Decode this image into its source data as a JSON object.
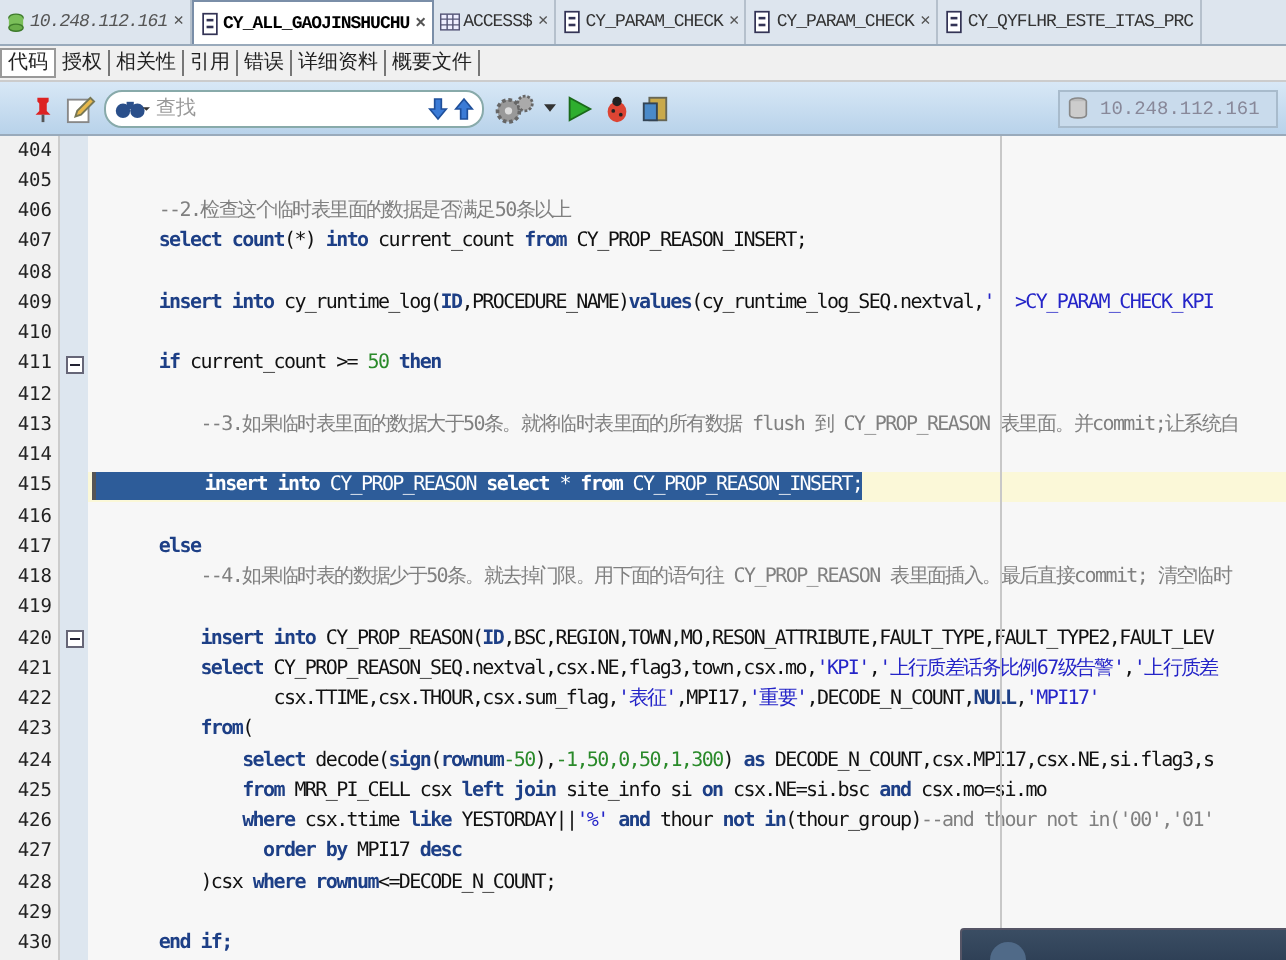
{
  "tabs": [
    {
      "label": "10.248.112.161",
      "kind": "connection",
      "selected": false,
      "close": "×"
    },
    {
      "label": "CY_ALL_GAOJINSHUCHU",
      "kind": "package",
      "selected": true,
      "close": "×"
    },
    {
      "label": "ACCESS$",
      "kind": "table",
      "selected": false,
      "close": "×"
    },
    {
      "label": "CY_PARAM_CHECK",
      "kind": "package",
      "selected": false,
      "close": "×"
    },
    {
      "label": "CY_PARAM_CHECK",
      "kind": "package",
      "selected": false,
      "close": "×"
    },
    {
      "label": "CY_QYFLHR_ESTE_ITAS_PRC",
      "kind": "package",
      "selected": false
    }
  ],
  "subtabs": [
    {
      "label": "代码",
      "selected": true
    },
    {
      "label": "授权",
      "selected": false
    },
    {
      "label": "相关性",
      "selected": false
    },
    {
      "label": "引用",
      "selected": false
    },
    {
      "label": "错误",
      "selected": false
    },
    {
      "label": "详细资料",
      "selected": false
    },
    {
      "label": "概要文件",
      "selected": false
    }
  ],
  "toolbar": {
    "search_placeholder": "查找",
    "connection": "10.248.112.161"
  },
  "lines": [
    {
      "number": "404",
      "fold": false,
      "selected": false
    },
    {
      "number": "405",
      "fold": false,
      "selected": false
    },
    {
      "number": "406",
      "fold": false,
      "selected": false,
      "segments": [
        {
          "kind": "comment",
          "text": "      --2.检查这个临时表里面的数据是否满足50条以上"
        }
      ]
    },
    {
      "number": "407",
      "fold": false,
      "selected": false,
      "segments": [
        {
          "kind": "keyword",
          "text": "      select "
        },
        {
          "kind": "keyword",
          "text": "count"
        },
        {
          "kind": "plain",
          "text": "(*) "
        },
        {
          "kind": "keyword",
          "text": "into"
        },
        {
          "kind": "plain",
          "text": " current_count "
        },
        {
          "kind": "keyword",
          "text": "from"
        },
        {
          "kind": "plain",
          "text": " CY_PROP_REASON_INSERT;"
        }
      ]
    },
    {
      "number": "408",
      "fold": false,
      "selected": false
    },
    {
      "number": "409",
      "fold": false,
      "selected": false,
      "segments": [
        {
          "kind": "keyword",
          "text": "      insert into"
        },
        {
          "kind": "plain",
          "text": " cy_runtime_log("
        },
        {
          "kind": "keyword",
          "text": "ID"
        },
        {
          "kind": "plain",
          "text": ",PROCEDURE_NAME)"
        },
        {
          "kind": "keyword",
          "text": "values"
        },
        {
          "kind": "plain",
          "text": "(cy_runtime_log_SEQ.nextval,"
        },
        {
          "kind": "string",
          "text": "'  >CY_PARAM_CHECK_KPI"
        }
      ]
    },
    {
      "number": "410",
      "fold": false,
      "selected": false
    },
    {
      "number": "411",
      "fold": true,
      "selected": false,
      "segments": [
        {
          "kind": "keyword",
          "text": "      if"
        },
        {
          "kind": "plain",
          "text": " current_count >= "
        },
        {
          "kind": "number",
          "text": "50"
        },
        {
          "kind": "keyword",
          "text": " then"
        }
      ]
    },
    {
      "number": "412",
      "fold": false,
      "selected": false
    },
    {
      "number": "413",
      "fold": false,
      "selected": false,
      "segments": [
        {
          "kind": "comment",
          "text": "          --3.如果临时表里面的数据大于50条。就将临时表里面的所有数据 flush 到 CY_PROP_REASON 表里面。并commit;让系统自"
        }
      ]
    },
    {
      "number": "414",
      "fold": false,
      "selected": false
    },
    {
      "number": "415",
      "fold": false,
      "selected": true,
      "segments": [
        {
          "kind": "keyword",
          "text": "          insert into"
        },
        {
          "kind": "plain",
          "text": " CY_PROP_REASON "
        },
        {
          "kind": "keyword",
          "text": "select"
        },
        {
          "kind": "plain",
          "text": " * "
        },
        {
          "kind": "keyword",
          "text": "from"
        },
        {
          "kind": "plain",
          "text": " CY_PROP_REASON_INSERT;"
        }
      ]
    },
    {
      "number": "416",
      "fold": false,
      "selected": false
    },
    {
      "number": "417",
      "fold": false,
      "selected": false,
      "segments": [
        {
          "kind": "keyword",
          "text": "      else"
        }
      ]
    },
    {
      "number": "418",
      "fold": false,
      "selected": false,
      "segments": [
        {
          "kind": "comment",
          "text": "          --4.如果临时表的数据少于50条。就去掉门限。用下面的语句往 CY_PROP_REASON 表里面插入。最后直接commit; 清空临时"
        }
      ]
    },
    {
      "number": "419",
      "fold": false,
      "selected": false
    },
    {
      "number": "420",
      "fold": true,
      "selected": false,
      "segments": [
        {
          "kind": "keyword",
          "text": "          insert into"
        },
        {
          "kind": "plain",
          "text": " CY_PROP_REASON("
        },
        {
          "kind": "keyword",
          "text": "ID"
        },
        {
          "kind": "plain",
          "text": ",BSC,REGION,TOWN,MO,RESON_ATTRIBUTE,FAULT_TYPE,FAULT_TYPE2,FAULT_LEV"
        }
      ]
    },
    {
      "number": "421",
      "fold": false,
      "selected": false,
      "segments": [
        {
          "kind": "keyword",
          "text": "          select"
        },
        {
          "kind": "plain",
          "text": " CY_PROP_REASON_SEQ.nextval,csx.NE,flag3,town,csx.mo,"
        },
        {
          "kind": "string",
          "text": "'KPI'"
        },
        {
          "kind": "plain",
          "text": ","
        },
        {
          "kind": "string",
          "text": "'上行质差话务比例67级告警'"
        },
        {
          "kind": "plain",
          "text": ","
        },
        {
          "kind": "string",
          "text": "'上行质差"
        }
      ]
    },
    {
      "number": "422",
      "fold": false,
      "selected": false,
      "segments": [
        {
          "kind": "plain",
          "text": "                 csx.TTIME,csx.THOUR,csx.sum_flag,"
        },
        {
          "kind": "string",
          "text": "'表征'"
        },
        {
          "kind": "plain",
          "text": ",MPI17,"
        },
        {
          "kind": "string",
          "text": "'重要'"
        },
        {
          "kind": "plain",
          "text": ",DECODE_N_COUNT,"
        },
        {
          "kind": "keyword",
          "text": "NULL"
        },
        {
          "kind": "plain",
          "text": ","
        },
        {
          "kind": "string",
          "text": "'MPI17'"
        }
      ]
    },
    {
      "number": "423",
      "fold": false,
      "selected": false,
      "segments": [
        {
          "kind": "keyword",
          "text": "          from"
        },
        {
          "kind": "plain",
          "text": "("
        }
      ]
    },
    {
      "number": "424",
      "fold": false,
      "selected": false,
      "segments": [
        {
          "kind": "keyword",
          "text": "              select"
        },
        {
          "kind": "plain",
          "text": " decode("
        },
        {
          "kind": "keyword",
          "text": "sign"
        },
        {
          "kind": "plain",
          "text": "("
        },
        {
          "kind": "keyword",
          "text": "rownum"
        },
        {
          "kind": "number",
          "text": "-50"
        },
        {
          "kind": "plain",
          "text": "),"
        },
        {
          "kind": "number",
          "text": "-1,50,0,50,1,300"
        },
        {
          "kind": "plain",
          "text": ") "
        },
        {
          "kind": "keyword",
          "text": "as"
        },
        {
          "kind": "plain",
          "text": " DECODE_N_COUNT,csx.MPI17,csx.NE,si.flag3,s"
        }
      ]
    },
    {
      "number": "425",
      "fold": false,
      "selected": false,
      "segments": [
        {
          "kind": "keyword",
          "text": "              from"
        },
        {
          "kind": "plain",
          "text": " MRR_PI_CELL csx "
        },
        {
          "kind": "keyword",
          "text": "left join"
        },
        {
          "kind": "plain",
          "text": " site_info si "
        },
        {
          "kind": "keyword",
          "text": "on"
        },
        {
          "kind": "plain",
          "text": " csx.NE=si.bsc "
        },
        {
          "kind": "keyword",
          "text": "and"
        },
        {
          "kind": "plain",
          "text": " csx.mo=si.mo"
        }
      ]
    },
    {
      "number": "426",
      "fold": false,
      "selected": false,
      "segments": [
        {
          "kind": "keyword",
          "text": "              where"
        },
        {
          "kind": "plain",
          "text": " csx.ttime "
        },
        {
          "kind": "keyword",
          "text": "like"
        },
        {
          "kind": "plain",
          "text": " YESTORDAY||"
        },
        {
          "kind": "string",
          "text": "'%'"
        },
        {
          "kind": "keyword",
          "text": " and"
        },
        {
          "kind": "plain",
          "text": " thour "
        },
        {
          "kind": "keyword",
          "text": "not in"
        },
        {
          "kind": "plain",
          "text": "(thour_group)"
        },
        {
          "kind": "comment",
          "text": "--and thour not in('00','01'"
        }
      ]
    },
    {
      "number": "427",
      "fold": false,
      "selected": false,
      "segments": [
        {
          "kind": "keyword",
          "text": "                order by"
        },
        {
          "kind": "plain",
          "text": " MPI17 "
        },
        {
          "kind": "keyword",
          "text": "desc"
        }
      ]
    },
    {
      "number": "428",
      "fold": false,
      "selected": false,
      "segments": [
        {
          "kind": "plain",
          "text": "          )csx "
        },
        {
          "kind": "keyword",
          "text": "where rownum"
        },
        {
          "kind": "plain",
          "text": "<=DECODE_N_COUNT;"
        }
      ]
    },
    {
      "number": "429",
      "fold": false,
      "selected": false
    },
    {
      "number": "430",
      "fold": false,
      "selected": false,
      "segments": [
        {
          "kind": "keyword",
          "text": "      end if;"
        }
      ]
    }
  ]
}
